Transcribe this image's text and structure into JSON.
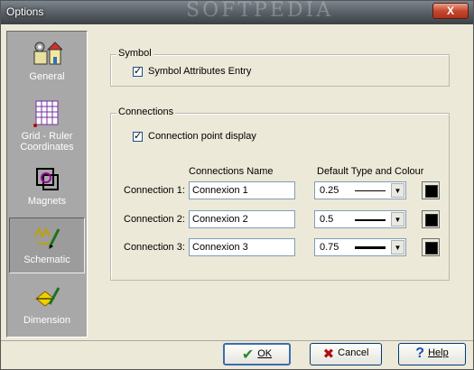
{
  "window": {
    "title": "Options",
    "watermark": "SOFTPEDIA",
    "close_label": "X"
  },
  "sidebar": {
    "items": [
      {
        "label": "General",
        "icon": "general-icon",
        "selected": false
      },
      {
        "label": "Grid - Ruler Coordinates",
        "icon": "grid-ruler-icon",
        "selected": false
      },
      {
        "label": "Magnets",
        "icon": "magnet-icon",
        "selected": false
      },
      {
        "label": "Schematic",
        "icon": "schematic-icon",
        "selected": true
      },
      {
        "label": "Dimension",
        "icon": "dimension-icon",
        "selected": false
      }
    ]
  },
  "symbol_group": {
    "title": "Symbol",
    "checkbox_label": "Symbol Attributes Entry",
    "checked": true
  },
  "connections_group": {
    "title": "Connections",
    "point_display_label": "Connection point display",
    "point_display_checked": true,
    "name_header": "Connections Name",
    "type_header": "Default Type and Colour",
    "rows": [
      {
        "label": "Connection 1:",
        "name": "Connexion 1",
        "width": "0.25",
        "color": "#000000"
      },
      {
        "label": "Connection 2:",
        "name": "Connexion 2",
        "width": "0.5",
        "color": "#000000"
      },
      {
        "label": "Connection 3:",
        "name": "Connexion 3",
        "width": "0.75",
        "color": "#000000"
      }
    ]
  },
  "buttons": {
    "ok": "OK",
    "cancel": "Cancel",
    "help": "Help"
  }
}
